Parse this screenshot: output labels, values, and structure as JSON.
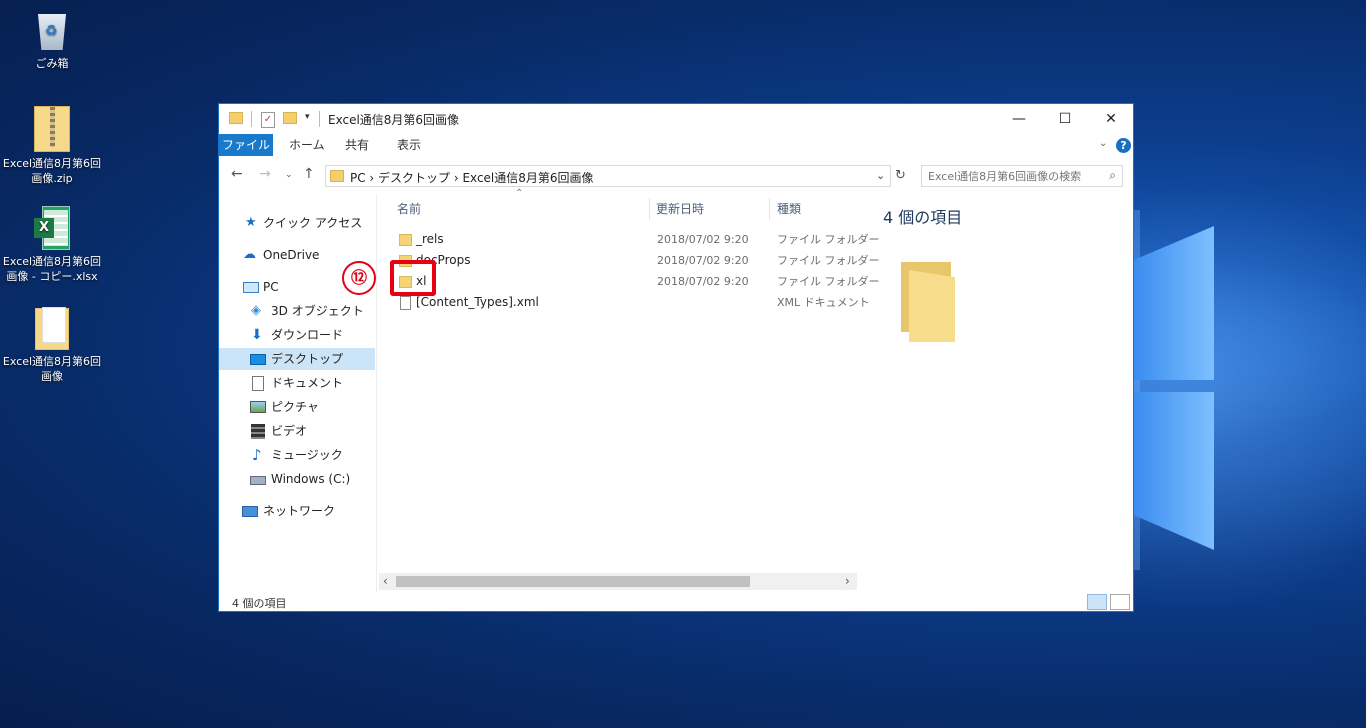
{
  "desktop": {
    "icons": [
      {
        "label": "ごみ箱"
      },
      {
        "label": "Excel通信8月第6回画像.zip"
      },
      {
        "label": "Excel通信8月第6回画像 - コピー.xlsx"
      },
      {
        "label": "Excel通信8月第6回画像"
      }
    ]
  },
  "window": {
    "title": "Excel通信8月第6回画像",
    "controls": {
      "minimize": "—",
      "maximize": "☐",
      "close": "✕"
    },
    "ribbon_tabs": [
      "ファイル",
      "ホーム",
      "共有",
      "表示"
    ],
    "help": "?",
    "address": {
      "crumbs": "PC  ›  デスクトップ  ›  Excel通信8月第6回画像"
    },
    "search_placeholder": "Excel通信8月第6回画像の検索",
    "nav_pane": [
      {
        "label": "クイック アクセス",
        "icon": "star-icon"
      },
      {
        "label": "OneDrive",
        "icon": "cloud-icon"
      },
      {
        "label": "PC",
        "icon": "pc-icon"
      },
      {
        "label": "3D オブジェクト",
        "icon": "cube-icon"
      },
      {
        "label": "ダウンロード",
        "icon": "download-icon"
      },
      {
        "label": "デスクトップ",
        "icon": "desktop-icon",
        "selected": true
      },
      {
        "label": "ドキュメント",
        "icon": "document-icon"
      },
      {
        "label": "ピクチャ",
        "icon": "picture-icon"
      },
      {
        "label": "ビデオ",
        "icon": "video-icon"
      },
      {
        "label": "ミュージック",
        "icon": "music-icon"
      },
      {
        "label": "Windows (C:)",
        "icon": "drive-icon"
      },
      {
        "label": "ネットワーク",
        "icon": "network-icon"
      }
    ],
    "columns": [
      "名前",
      "更新日時",
      "種類"
    ],
    "files": [
      {
        "name": "_rels",
        "modified": "2018/07/02 9:20",
        "type": "ファイル フォルダー",
        "kind": "folder"
      },
      {
        "name": "docProps",
        "modified": "2018/07/02 9:20",
        "type": "ファイル フォルダー",
        "kind": "folder"
      },
      {
        "name": "xl",
        "modified": "2018/07/02 9:20",
        "type": "ファイル フォルダー",
        "kind": "folder"
      },
      {
        "name": "[Content_Types].xml",
        "modified": "",
        "type": "XML ドキュメント",
        "kind": "xml"
      }
    ],
    "annotation_step": "⑫",
    "preview_count": "4 個の項目",
    "status": "4 個の項目"
  }
}
